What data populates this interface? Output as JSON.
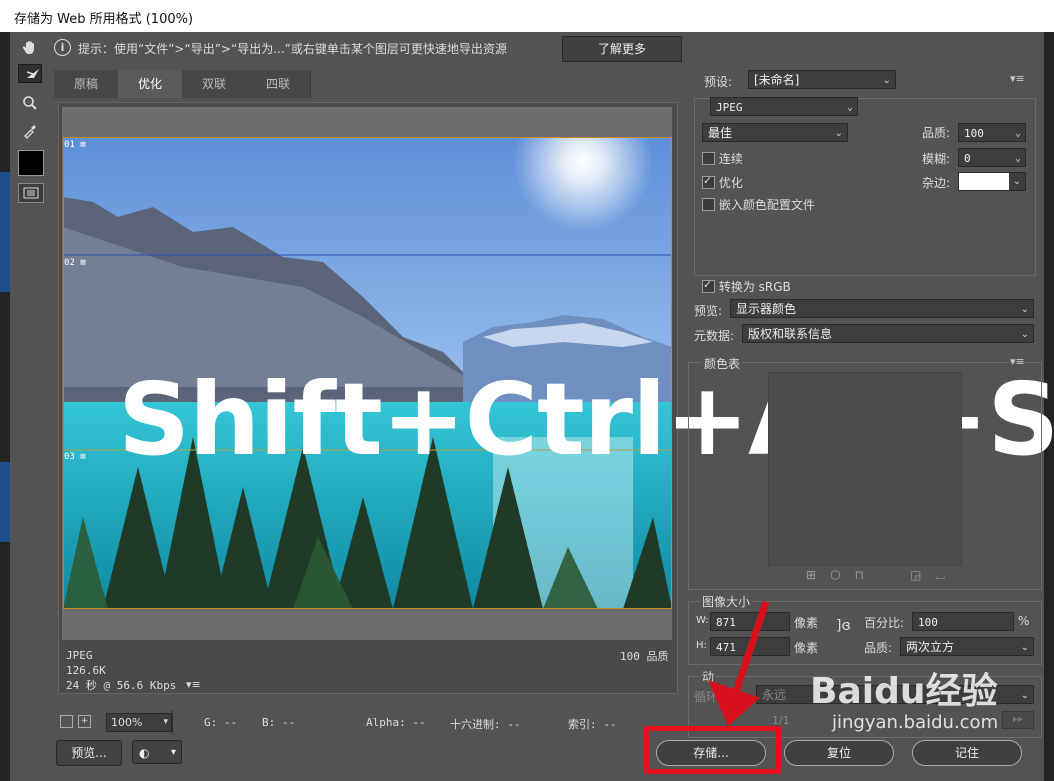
{
  "window": {
    "title": "存储为 Web 所用格式 (100%)"
  },
  "hint": {
    "text": "提示：使用“文件”>“导出”>“导出为...”或右键单击某个图层可更快速地导出资源",
    "learn_more": "了解更多"
  },
  "tabs": [
    "原稿",
    "优化",
    "双联",
    "四联"
  ],
  "slices": [
    "01",
    "02",
    "03"
  ],
  "overlay_text": "Shift+Ctrl+Alt+S",
  "preview_info": {
    "format": "JPEG",
    "size": "126.6K",
    "time": "24 秒 @ 56.6 Kbps",
    "quality": "100 品质"
  },
  "status": {
    "zoom": "100%",
    "g": "G: --",
    "b": "B: --",
    "alpha": "Alpha: --",
    "hex": "十六进制: --",
    "index": "索引: --"
  },
  "buttons": {
    "preview": "预览...",
    "save": "存储...",
    "reset": "复位",
    "remember": "记住"
  },
  "settings": {
    "preset_label": "预设:",
    "preset_value": "[未命名]",
    "format": "JPEG",
    "compression": "最佳",
    "quality_label": "品质:",
    "quality_value": "100",
    "blur_label": "模糊:",
    "blur_value": "0",
    "matte_label": "杂边:",
    "progressive": "连续",
    "optimized": "优化",
    "embed_profile": "嵌入颜色配置文件",
    "convert_srgb": "转换为 sRGB",
    "preview_label": "预览:",
    "preview_value": "显示器颜色",
    "metadata_label": "元数据:",
    "metadata_value": "版权和联系信息"
  },
  "color_table": {
    "title": "颜色表"
  },
  "image_size": {
    "title": "图像大小",
    "w_label": "W:",
    "w_value": "871",
    "h_label": "H:",
    "h_value": "471",
    "unit": "像素",
    "percent_label": "百分比:",
    "percent_value": "100",
    "percent_unit": "%",
    "quality_label": "品质:",
    "quality_value": "两次立方"
  },
  "animation": {
    "title": "动",
    "loop_label": "循环",
    "loop_value": "永远",
    "frame": "1/1"
  },
  "watermark": {
    "brand": "Baidu经验",
    "url": "jingyan.baidu.com"
  }
}
